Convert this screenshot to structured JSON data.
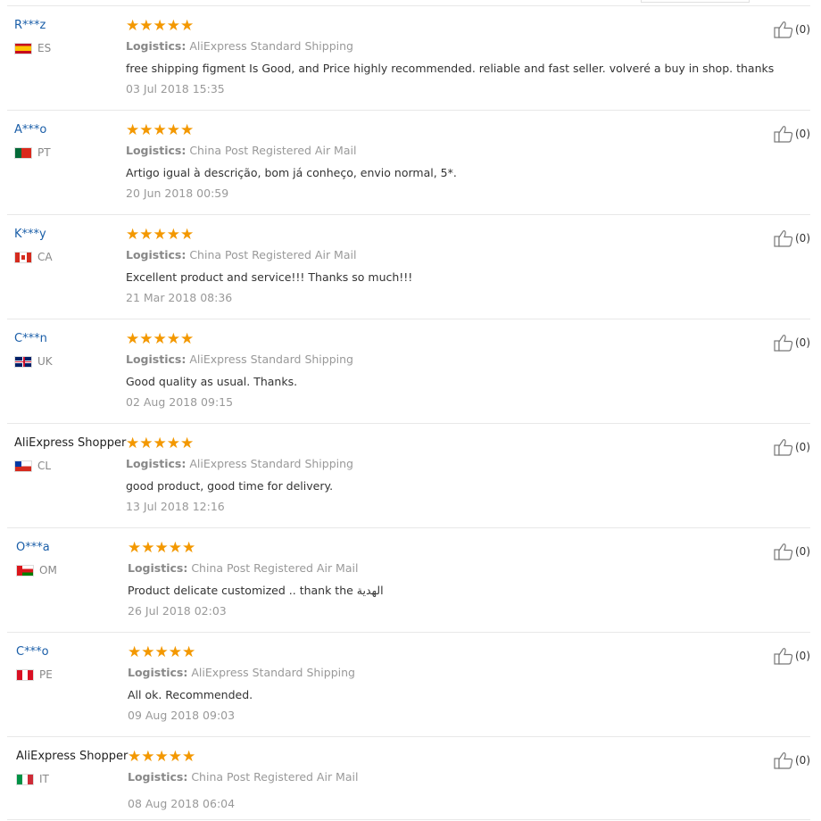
{
  "reviews": [
    {
      "user": "R***z",
      "country": "ES",
      "logistics_label": "Logistics:",
      "logistics": "AliExpress Standard Shipping",
      "text": "free shipping figment Is Good, and Price highly recommended. reliable and fast seller. volveré a buy in shop. thanks",
      "date": "03 Jul 2018 15:35",
      "helpful": "(0)",
      "stars": "★★★★★"
    },
    {
      "user": "A***o",
      "country": "PT",
      "logistics_label": "Logistics:",
      "logistics": "China Post Registered Air Mail",
      "text": "Artigo igual à descrição, bom já conheço, envio normal, 5*.",
      "date": "20 Jun 2018 00:59",
      "helpful": "(0)",
      "stars": "★★★★★"
    },
    {
      "user": "K***y",
      "country": "CA",
      "logistics_label": "Logistics:",
      "logistics": "China Post Registered Air Mail",
      "text": "Excellent product and service!!! Thanks so much!!!",
      "date": "21 Mar 2018 08:36",
      "helpful": "(0)",
      "stars": "★★★★★"
    },
    {
      "user": "C***n",
      "country": "UK",
      "logistics_label": "Logistics:",
      "logistics": "AliExpress Standard Shipping",
      "text": "Good quality as usual. Thanks.",
      "date": "02 Aug 2018 09:15",
      "helpful": "(0)",
      "stars": "★★★★★"
    },
    {
      "user": "AliExpress Shopper",
      "country": "CL",
      "logistics_label": "Logistics:",
      "logistics": "AliExpress Standard Shipping",
      "text": "good product, good time for delivery.",
      "date": "13 Jul 2018 12:16",
      "helpful": "(0)",
      "stars": "★★★★★"
    },
    {
      "user": "O***a",
      "country": "OM",
      "logistics_label": "Logistics:",
      "logistics": "China Post Registered Air Mail",
      "text": "Product delicate customized .. thank the الهدية",
      "date": "26 Jul 2018 02:03",
      "helpful": "(0)",
      "stars": "★★★★★"
    },
    {
      "user": "C***o",
      "country": "PE",
      "logistics_label": "Logistics:",
      "logistics": "AliExpress Standard Shipping",
      "text": "All ok. Recommended.",
      "date": "09 Aug 2018 09:03",
      "helpful": "(0)",
      "stars": "★★★★★"
    },
    {
      "user": "AliExpress Shopper",
      "country": "IT",
      "logistics_label": "Logistics:",
      "logistics": "China Post Registered Air Mail",
      "text": "",
      "date": "08 Aug 2018 06:04",
      "helpful": "(0)",
      "stars": "★★★★★"
    }
  ],
  "colors": {
    "star": "#f39800",
    "username_link": "#1a5ea8",
    "muted": "#999999"
  },
  "icons": {
    "helpful": "thumbs-up-icon",
    "rating": "star-icon"
  }
}
